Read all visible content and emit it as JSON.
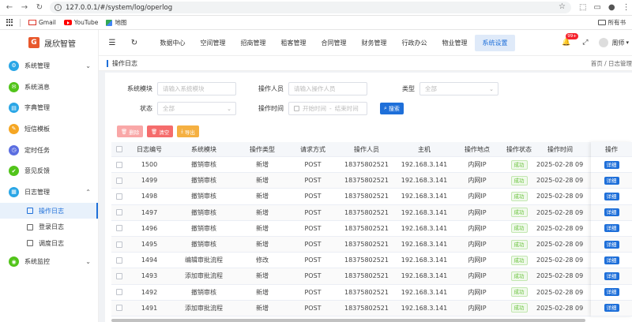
{
  "browser": {
    "url": "127.0.0.1/#/system/log/operlog",
    "bookmarks": [
      "Gmail",
      "YouTube",
      "地图"
    ],
    "all_bookmarks": "所有书"
  },
  "app": {
    "logo_char": "G",
    "title": "晟欣智管",
    "sidebar": [
      {
        "label": "系统管理",
        "icon": "settings-icon",
        "color": "#2aa6e6",
        "arrow": "chevron-down"
      },
      {
        "label": "系统消息",
        "icon": "message-icon",
        "color": "#52c41a",
        "arrow": ""
      },
      {
        "label": "字典管理",
        "icon": "book-icon",
        "color": "#2aa6e6",
        "arrow": ""
      },
      {
        "label": "短信模板",
        "icon": "sms-icon",
        "color": "#f5a623",
        "arrow": ""
      },
      {
        "label": "定时任务",
        "icon": "clock-icon",
        "color": "#5b6ee1",
        "arrow": ""
      },
      {
        "label": "意见反馈",
        "icon": "feedback-icon",
        "color": "#52c41a",
        "arrow": ""
      },
      {
        "label": "日志管理",
        "icon": "log-icon",
        "color": "#2aa6e6",
        "arrow": "chevron-up"
      }
    ],
    "sub_menu": [
      {
        "label": "操作日志",
        "active": true
      },
      {
        "label": "登录日志",
        "active": false
      },
      {
        "label": "调度日志",
        "active": false
      }
    ],
    "sidebar_last": {
      "label": "系统监控",
      "color": "#52c41a"
    },
    "top_nav": [
      "数据中心",
      "空间管理",
      "招商管理",
      "租客管理",
      "合同管理",
      "财务管理",
      "行政办公",
      "物业管理",
      "系统设置"
    ],
    "top_nav_active": 8,
    "notification_count": "99+",
    "username": "周师"
  },
  "breadcrumb": {
    "title": "操作日志",
    "right": "首页 / 日志管理"
  },
  "filters": {
    "module_label": "系统模块",
    "module_placeholder": "请输入系统模块",
    "operator_label": "操作人员",
    "operator_placeholder": "请输入操作人员",
    "type_label": "类型",
    "type_value": "全部",
    "status_label": "状态",
    "status_value": "全部",
    "time_label": "操作时间",
    "time_start": "开始时间",
    "time_sep": "-",
    "time_end": "结束时间",
    "search_btn": "搜索"
  },
  "actions": {
    "delete": "删除",
    "clear": "清空",
    "export": "导出"
  },
  "table": {
    "headers": [
      "日志编号",
      "系统模块",
      "操作类型",
      "请求方式",
      "操作人员",
      "主机",
      "操作地点",
      "操作状态",
      "操作时间",
      "操作"
    ],
    "rows": [
      {
        "id": "1500",
        "module": "撤销审核",
        "type": "新增",
        "method": "POST",
        "operator": "18375802521",
        "host": "192.168.3.141",
        "location": "内网IP",
        "status": "成功",
        "time": "2025-02-28 09:",
        "action": "详细"
      },
      {
        "id": "1499",
        "module": "撤销审核",
        "type": "新增",
        "method": "POST",
        "operator": "18375802521",
        "host": "192.168.3.141",
        "location": "内网IP",
        "status": "成功",
        "time": "2025-02-28 09:",
        "action": "详细"
      },
      {
        "id": "1498",
        "module": "撤销审核",
        "type": "新增",
        "method": "POST",
        "operator": "18375802521",
        "host": "192.168.3.141",
        "location": "内网IP",
        "status": "成功",
        "time": "2025-02-28 09:",
        "action": "详细"
      },
      {
        "id": "1497",
        "module": "撤销审核",
        "type": "新增",
        "method": "POST",
        "operator": "18375802521",
        "host": "192.168.3.141",
        "location": "内网IP",
        "status": "成功",
        "time": "2025-02-28 09:",
        "action": "详细"
      },
      {
        "id": "1496",
        "module": "撤销审核",
        "type": "新增",
        "method": "POST",
        "operator": "18375802521",
        "host": "192.168.3.141",
        "location": "内网IP",
        "status": "成功",
        "time": "2025-02-28 09:",
        "action": "详细"
      },
      {
        "id": "1495",
        "module": "撤销审核",
        "type": "新增",
        "method": "POST",
        "operator": "18375802521",
        "host": "192.168.3.141",
        "location": "内网IP",
        "status": "成功",
        "time": "2025-02-28 09:",
        "action": "详细"
      },
      {
        "id": "1494",
        "module": "编辑审批流程",
        "type": "修改",
        "method": "POST",
        "operator": "18375802521",
        "host": "192.168.3.141",
        "location": "内网IP",
        "status": "成功",
        "time": "2025-02-28 09:",
        "action": "详细"
      },
      {
        "id": "1493",
        "module": "添加审批流程",
        "type": "新增",
        "method": "POST",
        "operator": "18375802521",
        "host": "192.168.3.141",
        "location": "内网IP",
        "status": "成功",
        "time": "2025-02-28 09:",
        "action": "详细"
      },
      {
        "id": "1492",
        "module": "撤销审核",
        "type": "新增",
        "method": "POST",
        "operator": "18375802521",
        "host": "192.168.3.141",
        "location": "内网IP",
        "status": "成功",
        "time": "2025-02-28 09:",
        "action": "详细"
      },
      {
        "id": "1491",
        "module": "添加审批流程",
        "type": "新增",
        "method": "POST",
        "operator": "18375802521",
        "host": "192.168.3.141",
        "location": "内网IP",
        "status": "成功",
        "time": "2025-02-28 09:",
        "action": "详细"
      }
    ]
  }
}
